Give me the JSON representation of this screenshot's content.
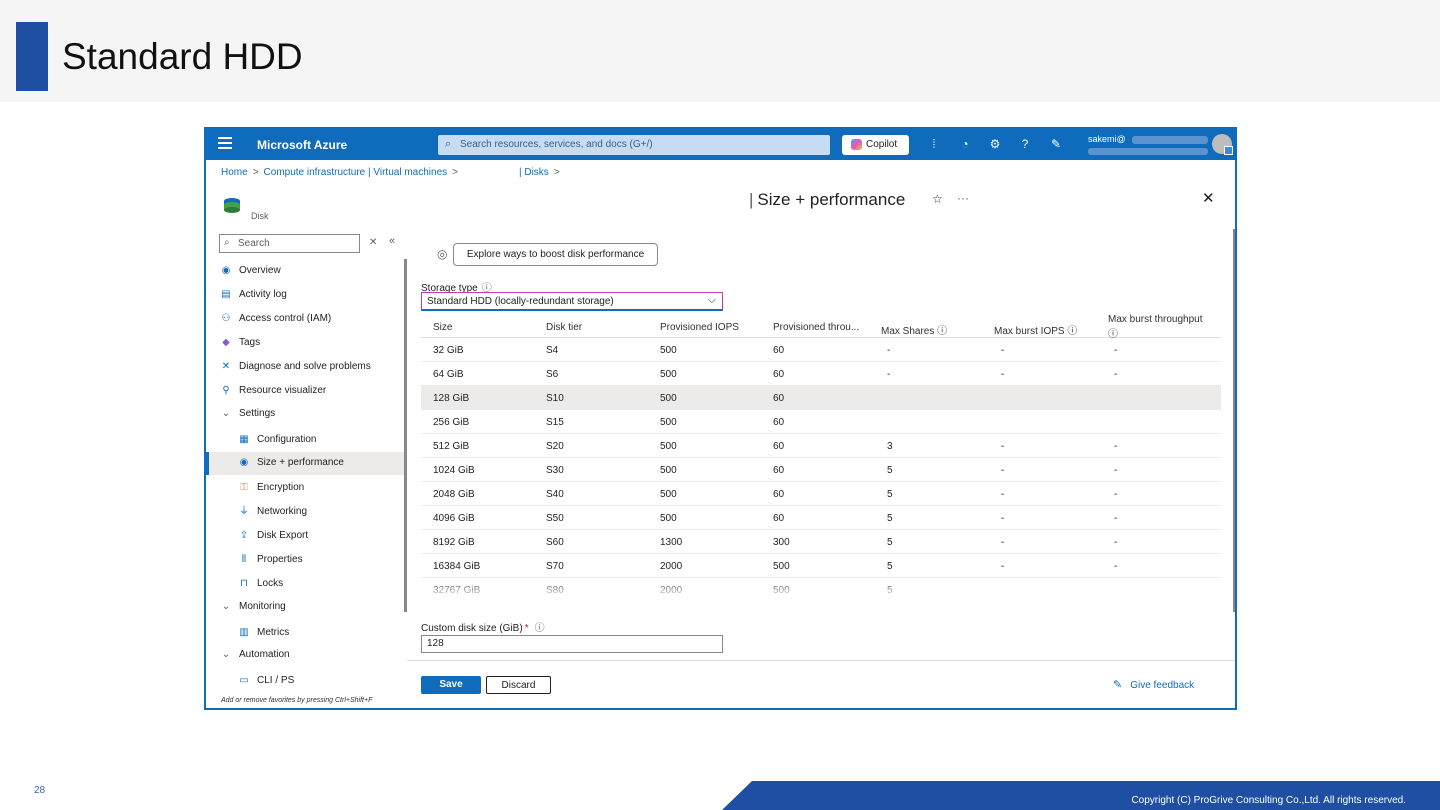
{
  "slide": {
    "title": "Standard HDD",
    "page_number": "28",
    "copyright": "Copyright (C) ProGrive Consulting Co.,Ltd. All rights reserved."
  },
  "topbar": {
    "brand": "Microsoft Azure",
    "search_placeholder": "Search resources, services, and docs (G+/)",
    "copilot_label": "Copilot",
    "account": "sakemi@"
  },
  "breadcrumb": {
    "items": [
      "Home",
      "Compute infrastructure | Virtual machines",
      "| Disks"
    ]
  },
  "resource": {
    "type_label": "Disk",
    "blade_title": "Size + performance"
  },
  "sidebar": {
    "search_placeholder": "Search",
    "items": [
      {
        "label": "Overview",
        "icon": "disk-icon"
      },
      {
        "label": "Activity log",
        "icon": "log-icon"
      },
      {
        "label": "Access control (IAM)",
        "icon": "people-icon"
      },
      {
        "label": "Tags",
        "icon": "tag-icon"
      },
      {
        "label": "Diagnose and solve problems",
        "icon": "wrench-icon"
      },
      {
        "label": "Resource visualizer",
        "icon": "hierarchy-icon"
      },
      {
        "label": "Settings",
        "icon": "chevron-down-icon"
      },
      {
        "label": "Configuration",
        "icon": "configuration-icon"
      },
      {
        "label": "Size + performance",
        "icon": "disk-icon"
      },
      {
        "label": "Encryption",
        "icon": "key-icon"
      },
      {
        "label": "Networking",
        "icon": "network-icon"
      },
      {
        "label": "Disk Export",
        "icon": "export-icon"
      },
      {
        "label": "Properties",
        "icon": "properties-icon"
      },
      {
        "label": "Locks",
        "icon": "lock-icon"
      },
      {
        "label": "Monitoring",
        "icon": "chevron-down-icon"
      },
      {
        "label": "Metrics",
        "icon": "metrics-icon"
      },
      {
        "label": "Automation",
        "icon": "chevron-down-icon"
      },
      {
        "label": "CLI / PS",
        "icon": "terminal-icon"
      }
    ],
    "favorites_hint": "Add or remove favorites by pressing Ctrl+Shift+F"
  },
  "main": {
    "boost_button": "Explore ways to boost disk performance",
    "storage_type_label": "Storage type",
    "storage_type_value": "Standard HDD (locally-redundant storage)",
    "table": {
      "headers": [
        "Size",
        "Disk tier",
        "Provisioned IOPS",
        "Provisioned throu...",
        "Max Shares",
        "Max burst IOPS",
        "Max burst throughput"
      ],
      "rows": [
        [
          "32 GiB",
          "S4",
          "500",
          "60",
          "-",
          "-",
          "-"
        ],
        [
          "64 GiB",
          "S6",
          "500",
          "60",
          "-",
          "-",
          "-"
        ],
        [
          "128 GiB",
          "S10",
          "500",
          "60",
          "",
          "",
          ""
        ],
        [
          "256 GiB",
          "S15",
          "500",
          "60",
          "",
          "",
          ""
        ],
        [
          "512 GiB",
          "S20",
          "500",
          "60",
          "3",
          "-",
          "-"
        ],
        [
          "1024 GiB",
          "S30",
          "500",
          "60",
          "5",
          "-",
          "-"
        ],
        [
          "2048 GiB",
          "S40",
          "500",
          "60",
          "5",
          "-",
          "-"
        ],
        [
          "4096 GiB",
          "S50",
          "500",
          "60",
          "5",
          "-",
          "-"
        ],
        [
          "8192 GiB",
          "S60",
          "1300",
          "300",
          "5",
          "-",
          "-"
        ],
        [
          "16384 GiB",
          "S70",
          "2000",
          "500",
          "5",
          "-",
          "-"
        ],
        [
          "32767 GiB",
          "S80",
          "2000",
          "500",
          "5",
          "",
          ""
        ]
      ],
      "highlighted_row": 2
    },
    "custom_size_label": "Custom disk size (GiB)",
    "custom_size_required": "*",
    "custom_size_value": "128",
    "save_label": "Save",
    "discard_label": "Discard",
    "feedback_label": "Give feedback"
  },
  "colors": {
    "azure_blue": "#0f6cbd",
    "slide_accent": "#1f4fa3",
    "row_highlight": "#edebe9"
  }
}
